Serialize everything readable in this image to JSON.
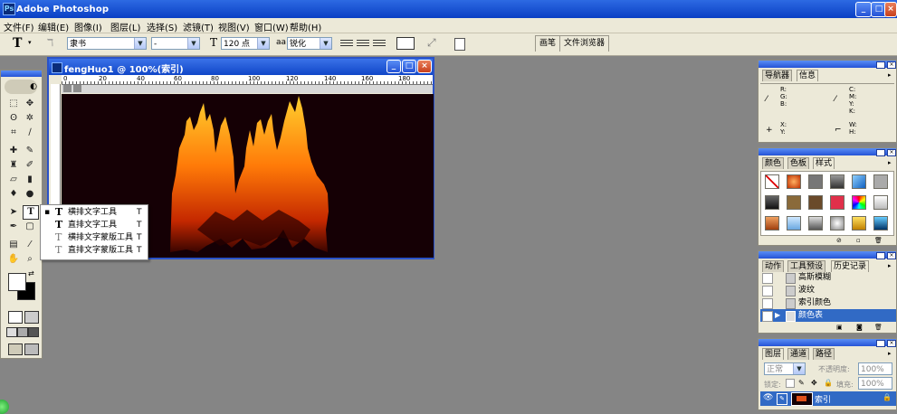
{
  "app": {
    "title": "Adobe Photoshop",
    "icon_name": "photoshop-icon"
  },
  "window_controls": {
    "minimize": "_",
    "restore": "□",
    "close": "×"
  },
  "menu": [
    "文件(F)",
    "编辑(E)",
    "图像(I)",
    "图层(L)",
    "选择(S)",
    "滤镜(T)",
    "视图(V)",
    "窗口(W)",
    "帮助(H)"
  ],
  "options": {
    "tool_glyph": "T",
    "font_family": "隶书",
    "font_style": "-",
    "font_size": "120 点",
    "aa_label": "aa",
    "antialias": "锐化",
    "wells": [
      "画笔",
      "文件浏览器"
    ]
  },
  "document": {
    "title": "fengHuo1 @ 100%(索引)",
    "ruler_marks": [
      "0",
      "20",
      "40",
      "60",
      "80",
      "100",
      "120",
      "140",
      "160",
      "180"
    ],
    "canvas_color": "#150005"
  },
  "flyout": {
    "items": [
      {
        "label": "横排文字工具",
        "key": "T",
        "active": true
      },
      {
        "label": "直排文字工具",
        "key": "T"
      },
      {
        "label": "横排文字蒙版工具",
        "key": "T"
      },
      {
        "label": "直排文字蒙版工具",
        "key": "T"
      }
    ]
  },
  "navigator_panel": {
    "tabs": [
      "导航器",
      "信息"
    ],
    "rgb": [
      "R",
      "G",
      "B"
    ],
    "cmyk": [
      "C",
      "M",
      "Y",
      "K"
    ],
    "xy": [
      "X",
      "Y"
    ],
    "wh": [
      "W",
      "H"
    ]
  },
  "styles_panel": {
    "tabs": [
      "颜色",
      "色板",
      "样式"
    ]
  },
  "history_panel": {
    "tabs": [
      "动作",
      "工具预设",
      "历史记录"
    ],
    "items": [
      "高斯模糊",
      "波纹",
      "索引颜色",
      "颜色表"
    ],
    "selected_index": 3
  },
  "layers_panel": {
    "tabs": [
      "图层",
      "通道",
      "路径"
    ],
    "blend_mode": "正常",
    "opacity_label": "不透明度:",
    "opacity_value": "100%",
    "lock_label": "锁定:",
    "fill_label": "填充:",
    "fill_value": "100%",
    "layer_name": "索引"
  },
  "colors": {
    "accent": "#2a52c8",
    "selection": "#316ac5",
    "panel_bg": "#ece9d8",
    "workspace": "#858585"
  }
}
